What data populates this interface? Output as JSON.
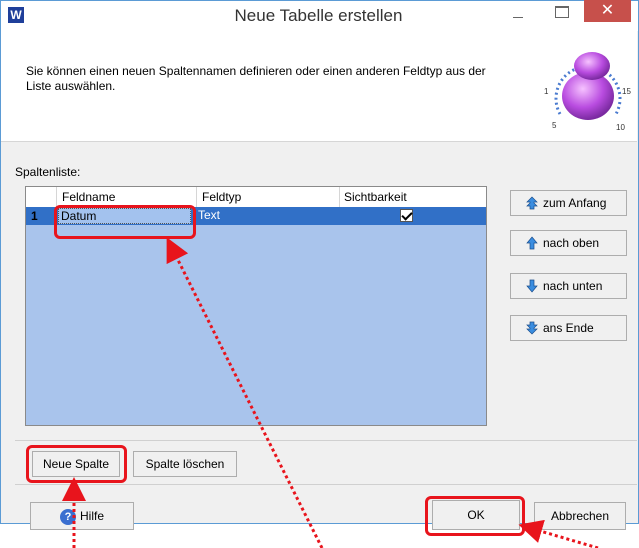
{
  "window": {
    "title": "Neue Tabelle erstellen",
    "app_icon_letter": "W",
    "close_glyph": "✕"
  },
  "header": {
    "description": "Sie können einen neuen Spaltennamen definieren oder einen anderen Feldtyp aus der Liste auswählen.",
    "icon": "knob-dial-icon",
    "dial_labels": [
      "1",
      "5",
      "10",
      "15"
    ]
  },
  "columns_section": {
    "label": "Spaltenliste:",
    "headers": [
      "Feldname",
      "Feldtyp",
      "Sichtbarkeit"
    ],
    "rows": [
      {
        "num": "1",
        "feldname": "Datum",
        "feldtyp": "Text",
        "sichtbarkeit": true
      }
    ]
  },
  "side_buttons": [
    {
      "label": "zum Anfang",
      "icon": "double-arrow-up-icon"
    },
    {
      "label": "nach oben",
      "icon": "arrow-up-icon"
    },
    {
      "label": "nach unten",
      "icon": "arrow-down-icon"
    },
    {
      "label": "ans Ende",
      "icon": "double-arrow-down-icon"
    }
  ],
  "column_buttons": {
    "new": "Neue Spalte",
    "delete": "Spalte löschen"
  },
  "footer": {
    "help": "Hilfe",
    "ok": "OK",
    "cancel": "Abbrechen"
  },
  "colors": {
    "highlight": "#e8141c",
    "selected_row": "#3170c7",
    "grid_bg": "#a9c4ec"
  }
}
